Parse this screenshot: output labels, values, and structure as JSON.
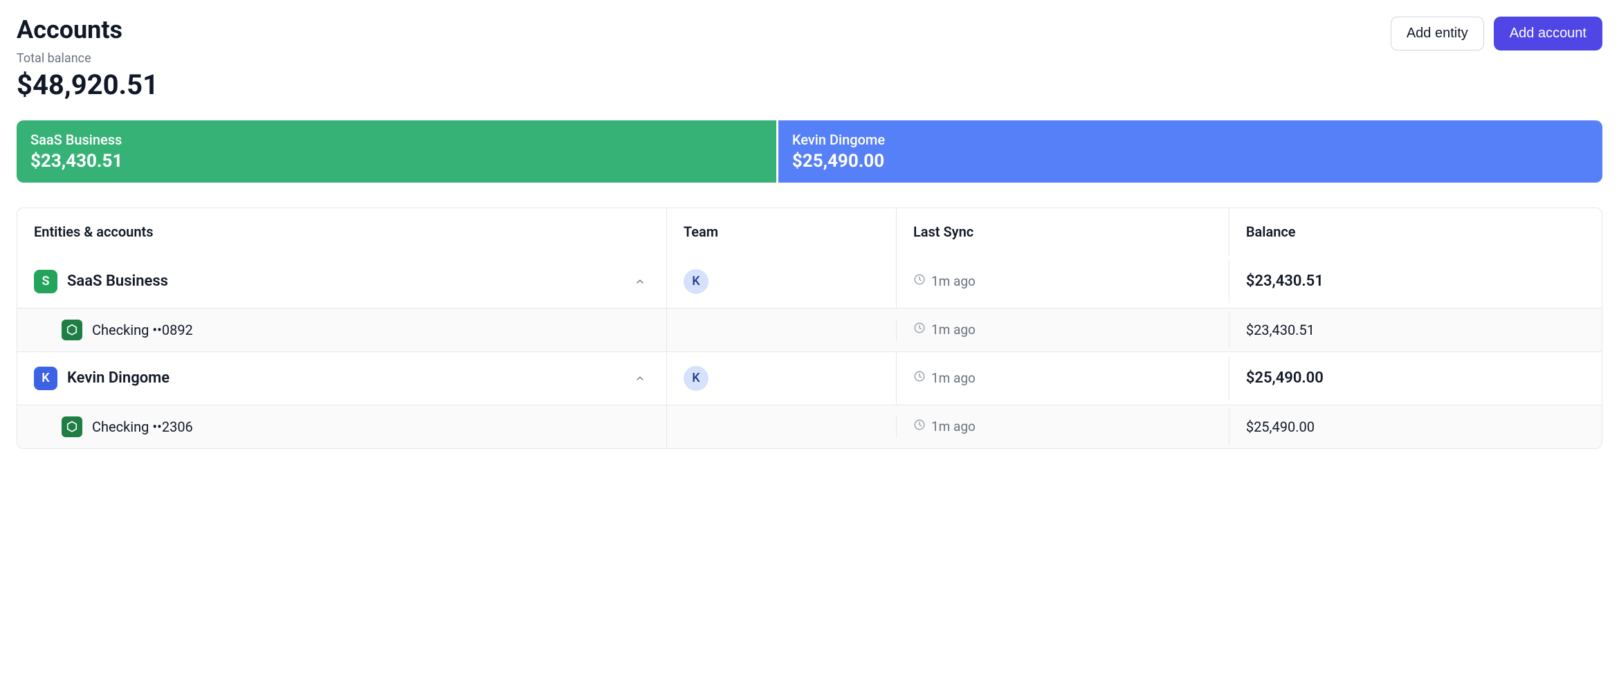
{
  "header": {
    "title": "Accounts",
    "total_label": "Total balance",
    "total_value": "$48,920.51",
    "add_entity": "Add entity",
    "add_account": "Add account"
  },
  "bar": {
    "segments": [
      {
        "name": "SaaS Business",
        "amount": "$23,430.51",
        "color": "green",
        "weight": 47.9
      },
      {
        "name": "Kevin Dingome",
        "amount": "$25,490.00",
        "color": "blue",
        "weight": 52.1
      }
    ]
  },
  "table": {
    "headers": {
      "entities": "Entities & accounts",
      "team": "Team",
      "last_sync": "Last Sync",
      "balance": "Balance"
    },
    "entities": [
      {
        "initial": "S",
        "badge_color": "green",
        "name": "SaaS Business",
        "team_initial": "K",
        "last_sync": "1m ago",
        "balance": "$23,430.51",
        "accounts": [
          {
            "name": "Checking ••0892",
            "last_sync": "1m ago",
            "balance": "$23,430.51"
          }
        ]
      },
      {
        "initial": "K",
        "badge_color": "blue",
        "name": "Kevin Dingome",
        "team_initial": "K",
        "last_sync": "1m ago",
        "balance": "$25,490.00",
        "accounts": [
          {
            "name": "Checking ••2306",
            "last_sync": "1m ago",
            "balance": "$25,490.00"
          }
        ]
      }
    ]
  }
}
